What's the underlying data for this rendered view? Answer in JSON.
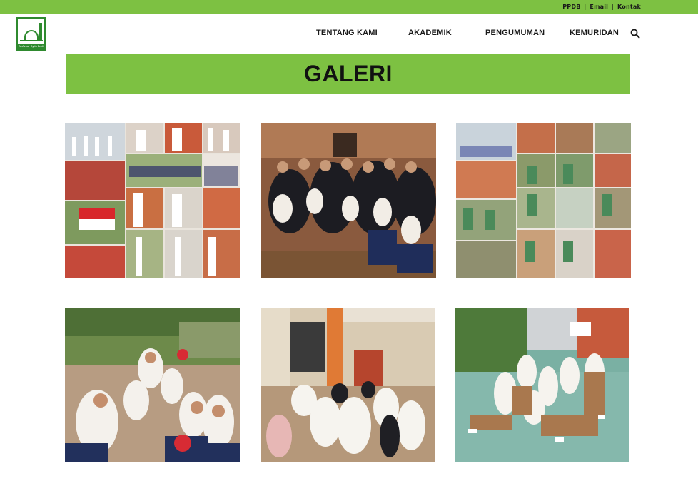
{
  "topbar": {
    "links": [
      "PPDB",
      "Email",
      "Kontak"
    ],
    "separator": "|"
  },
  "logo": {
    "caption": "Al-Azhar Syifa Budi"
  },
  "nav": {
    "items": [
      "TENTANG KAMI",
      "AKADEMIK",
      "PENGUMUMAN",
      "KEMURIDAN"
    ],
    "search_icon": "search-icon"
  },
  "page": {
    "title": "GALERI"
  },
  "gallery": {
    "photos": [
      {
        "kind": "collage",
        "subject": "flag ceremony"
      },
      {
        "kind": "group",
        "subject": "graduation"
      },
      {
        "kind": "collage",
        "subject": "students with packages"
      },
      {
        "kind": "group",
        "subject": "students posing"
      },
      {
        "kind": "group",
        "subject": "students sitting"
      },
      {
        "kind": "group",
        "subject": "students in courtyard"
      }
    ]
  },
  "colors": {
    "accent": "#7dc142",
    "text": "#1a1a1a",
    "logo_green": "#2f8a2f"
  }
}
